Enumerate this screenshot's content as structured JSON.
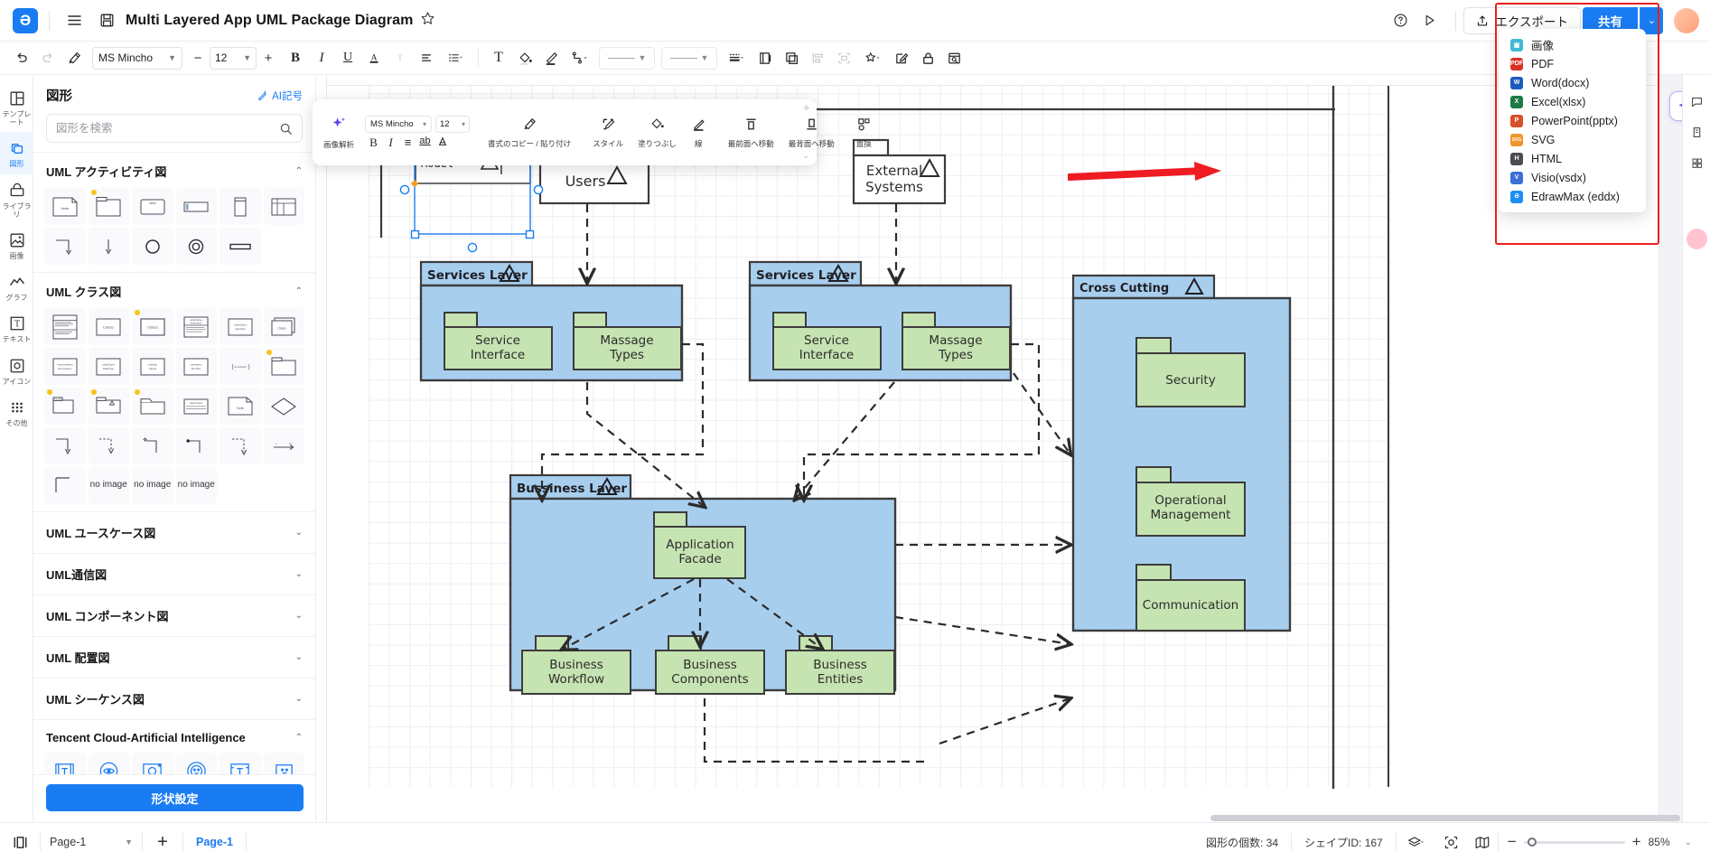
{
  "app": {
    "logo": "edraw-logo",
    "doc_title": "Multi Layered App UML Package Diagram",
    "menu_icon": "hamburger-icon",
    "save_icon": "save-icon",
    "star_icon": "star-icon",
    "help_icon": "help-icon",
    "present_icon": "present-icon"
  },
  "topbar": {
    "export_label": "エクスポート",
    "share_label": "共有",
    "share_caret": "⌄"
  },
  "format_toolbar": {
    "undo": "undo-icon",
    "redo": "redo-icon",
    "format_painter": "format-painter-icon",
    "font_family": "MS Mincho",
    "font_size": "12",
    "minus": "−",
    "plus": "+",
    "bold": "B",
    "italic": "I",
    "underline": "U",
    "font_color": "A",
    "strikethrough": "T",
    "align": "align-icon",
    "line_spacing": "line-spacing-icon",
    "text_box": "T",
    "fill": "fill-bucket-icon",
    "pen": "pen-icon",
    "connector": "connector-icon",
    "line_style_1": "line-style",
    "line_style_2": "line-weight",
    "line_dash": "dash-style-icon",
    "duplicate": "duplicate-icon",
    "copy": "copy-icon",
    "align_objects": "align-objects-icon",
    "distribute": "distribute-icon",
    "effects": "effects-icon",
    "edit": "edit-icon",
    "lock": "lock-icon",
    "find": "find-replace-icon"
  },
  "left_rail": [
    {
      "id": "templates",
      "icon": "template-icon",
      "label": "テンプレート",
      "active": false
    },
    {
      "id": "shapes",
      "icon": "shapes-icon",
      "label": "図形",
      "active": true
    },
    {
      "id": "library",
      "icon": "library-icon",
      "label": "ライブラリ",
      "active": false
    },
    {
      "id": "images",
      "icon": "image-icon",
      "label": "画像",
      "active": false
    },
    {
      "id": "charts",
      "icon": "chart-icon",
      "label": "グラフ",
      "active": false
    },
    {
      "id": "text",
      "icon": "text-icon",
      "label": "テキスト",
      "active": false
    },
    {
      "id": "icons",
      "icon": "icon-icon",
      "label": "アイコン",
      "active": false
    },
    {
      "id": "others",
      "icon": "grid-dots-icon",
      "label": "その他",
      "active": false
    }
  ],
  "shape_panel": {
    "title": "図形",
    "ai_symbol_label": "AI記号",
    "ai_symbol_icon": "ai-wand-icon",
    "search_placeholder": "図形を検索",
    "search_value": "",
    "search_icon": "search-icon",
    "sections": [
      {
        "title": "UML アクティビティ図",
        "expanded": true,
        "chevron": "⌃"
      },
      {
        "title": "UML クラス図",
        "expanded": true,
        "chevron": "⌃"
      },
      {
        "title": "UML ユースケース図",
        "expanded": false,
        "chevron": "⌄"
      },
      {
        "title": "UML通信図",
        "expanded": false,
        "chevron": "⌄"
      },
      {
        "title": "UML コンポーネント図",
        "expanded": false,
        "chevron": "⌄"
      },
      {
        "title": "UML 配置図",
        "expanded": false,
        "chevron": "⌄"
      },
      {
        "title": "UML シーケンス図",
        "expanded": false,
        "chevron": "⌄"
      },
      {
        "title": "Tencent Cloud-Artificial Intelligence",
        "expanded": true,
        "chevron": "⌃"
      }
    ],
    "no_image_label": "no image",
    "cta_label": "形状設定"
  },
  "export_menu": {
    "items": [
      {
        "label": "画像",
        "icon": "image-export-icon",
        "color": "#3fb9d6",
        "glyph": "▣"
      },
      {
        "label": "PDF",
        "icon": "pdf-export-icon",
        "color": "#d93025",
        "glyph": "P"
      },
      {
        "label": "Word(docx)",
        "icon": "word-export-icon",
        "color": "#1b5bbf",
        "glyph": "W"
      },
      {
        "label": "Excel(xlsx)",
        "icon": "excel-export-icon",
        "color": "#1d7a43",
        "glyph": "X"
      },
      {
        "label": "PowerPoint(pptx)",
        "icon": "powerpoint-export-icon",
        "color": "#d6502a",
        "glyph": "P"
      },
      {
        "label": "SVG",
        "icon": "svg-export-icon",
        "color": "#f0962a",
        "glyph": "S"
      },
      {
        "label": "HTML",
        "icon": "html-export-icon",
        "color": "#4b4b52",
        "glyph": "H"
      },
      {
        "label": "Visio(vsdx)",
        "icon": "visio-export-icon",
        "color": "#3b6ed6",
        "glyph": "V"
      },
      {
        "label": "EdrawMax (eddx)",
        "icon": "edrawmax-export-icon",
        "color": "#1f8ef1",
        "glyph": "Ɔ"
      }
    ]
  },
  "annotation": {
    "highlight_color": "#ea2020",
    "arrow_color": "#ee1c23"
  },
  "right_rail": {
    "ai_icon": "ai-sparkle-icon",
    "items": [
      "comment-icon",
      "notes-icon",
      "layers-icon"
    ]
  },
  "status_bar": {
    "fit_icon": "fit-page-icon",
    "page_select": "Page-1",
    "add_page": "+",
    "page_tab": "Page-1",
    "shape_count_label": "図形の個数: 34",
    "shape_id_label": "シェイプID: 167",
    "layers_icon": "layers-icon",
    "focus_icon": "focus-icon",
    "map_icon": "minimap-icon",
    "zoom_minus": "−",
    "zoom_plus": "+",
    "zoom_value": "85%",
    "zoom_caret": "⌄"
  },
  "diagram": {
    "title": "Multi Layered App UML Package Diagram",
    "colors": {
      "layer_fill": "#a8ceee",
      "package_fill": "#c6e3b2",
      "plain_fill": "#ffffff",
      "stroke": "#3c3c3c",
      "selection": "#1a7cf3",
      "handle": "#f0a020"
    },
    "packages": [
      {
        "id": "model",
        "label": "Model",
        "kind": "plain",
        "selected": true
      },
      {
        "id": "users",
        "label": "Users",
        "kind": "plain",
        "selected": false
      },
      {
        "id": "external",
        "label": "External\nSystems",
        "kind": "plain",
        "selected": false
      },
      {
        "id": "services1",
        "label": "Services Layer",
        "kind": "layer",
        "selected": false
      },
      {
        "id": "services2",
        "label": "Services Layer",
        "kind": "layer",
        "selected": false
      },
      {
        "id": "business",
        "label": "Bussiness Layer",
        "kind": "layer",
        "selected": false
      },
      {
        "id": "crosscutting",
        "label": "Cross Cutting",
        "kind": "layer",
        "selected": false
      },
      {
        "id": "svc-if-1",
        "label": "Service\nInterface",
        "kind": "package",
        "selected": false
      },
      {
        "id": "msg-types-1",
        "label": "Massage\nTypes",
        "kind": "package",
        "selected": false
      },
      {
        "id": "svc-if-2",
        "label": "Service\nInterface",
        "kind": "package",
        "selected": false
      },
      {
        "id": "msg-types-2",
        "label": "Massage\nTypes",
        "kind": "package",
        "selected": false
      },
      {
        "id": "app-facade",
        "label": "Application\nFacade",
        "kind": "package",
        "selected": false
      },
      {
        "id": "biz-workflow",
        "label": "Business\nWorkflow",
        "kind": "package",
        "selected": false
      },
      {
        "id": "biz-comp",
        "label": "Business\nComponents",
        "kind": "package",
        "selected": false
      },
      {
        "id": "biz-entities",
        "label": "Business\nEntities",
        "kind": "package",
        "selected": false
      },
      {
        "id": "security",
        "label": "Security",
        "kind": "package",
        "selected": false
      },
      {
        "id": "op-mgmt",
        "label": "Operational\nManagement",
        "kind": "package",
        "selected": false
      },
      {
        "id": "communication",
        "label": "Communication",
        "kind": "package",
        "selected": false
      }
    ],
    "labels": {
      "model": "Model",
      "users": "Users",
      "external_1": "External",
      "external_2": "Systems",
      "services_layer_1": "Services Layer",
      "services_layer_2": "Services Layer",
      "svc_if_1a": "Service",
      "svc_if_1b": "Interface",
      "msg_1a": "Massage",
      "msg_1b": "Types",
      "svc_if_2a": "Service",
      "svc_if_2b": "Interface",
      "msg_2a": "Massage",
      "msg_2b": "Types",
      "business_layer": "Bussiness Layer",
      "app_facade_a": "Application",
      "app_facade_b": "Facade",
      "biz_wf_a": "Business",
      "biz_wf_b": "Workflow",
      "biz_cp_a": "Business",
      "biz_cp_b": "Components",
      "biz_en_a": "Business",
      "biz_en_b": "Entities",
      "cross_cutting": "Cross Cutting",
      "security": "Security",
      "op_mgmt_a": "Operational",
      "op_mgmt_b": "Management",
      "communication": "Communication"
    }
  }
}
